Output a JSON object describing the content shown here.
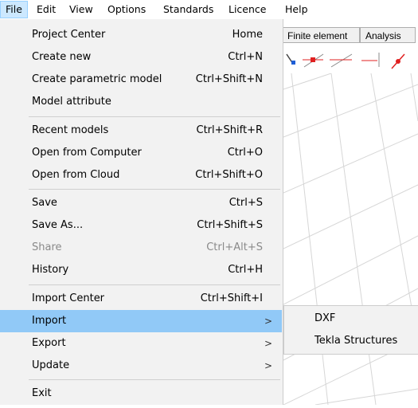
{
  "menubar": {
    "items": [
      "File",
      "Edit",
      "View",
      "Options",
      "Standards",
      "Licence",
      "Help"
    ]
  },
  "background": {
    "tabs": [
      "Finite element",
      "Analysis"
    ]
  },
  "file_menu": {
    "groups": [
      [
        {
          "label": "Project Center",
          "shortcut": "Home"
        },
        {
          "label": "Create new",
          "shortcut": "Ctrl+N"
        },
        {
          "label": "Create parametric model",
          "shortcut": "Ctrl+Shift+N"
        },
        {
          "label": "Model attribute",
          "shortcut": ""
        }
      ],
      [
        {
          "label": "Recent models",
          "shortcut": "Ctrl+Shift+R"
        },
        {
          "label": "Open from Computer",
          "shortcut": "Ctrl+O"
        },
        {
          "label": "Open from Cloud",
          "shortcut": "Ctrl+Shift+O"
        }
      ],
      [
        {
          "label": "Save",
          "shortcut": "Ctrl+S"
        },
        {
          "label": "Save As...",
          "shortcut": "Ctrl+Shift+S"
        },
        {
          "label": "Share",
          "shortcut": "Ctrl+Alt+S",
          "disabled": true
        },
        {
          "label": "History",
          "shortcut": "Ctrl+H"
        }
      ],
      [
        {
          "label": "Import Center",
          "shortcut": "Ctrl+Shift+I"
        },
        {
          "label": "Import",
          "submenu_arrow": ">",
          "highlighted": true
        },
        {
          "label": "Export",
          "submenu_arrow": ">"
        },
        {
          "label": "Update",
          "submenu_arrow": ">"
        }
      ],
      [
        {
          "label": "Exit",
          "shortcut": ""
        }
      ]
    ]
  },
  "import_submenu": {
    "items": [
      "DXF",
      "Tekla Structures"
    ]
  },
  "colors": {
    "menu_bg": "#f2f2f2",
    "highlight": "#91c9f7",
    "active_menubar": "#cce8ff",
    "grid_line": "#d6d6d6"
  }
}
